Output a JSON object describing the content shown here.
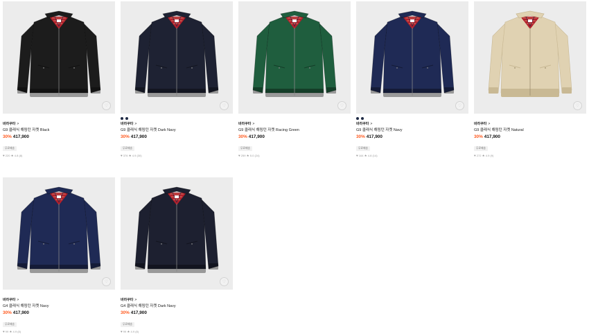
{
  "products": [
    {
      "brand": "바라쿠타",
      "brand_chevron": ">",
      "name": "G9 클래식 해링턴 자켓 Black",
      "discount": "30%",
      "price": "417,900",
      "badge": "무료배송",
      "likes": "220",
      "rating": "4.8 (8)",
      "color": "#1c1c1c",
      "colors_count": 0,
      "heart": "heart-outline-icon"
    },
    {
      "brand": "바라쿠타",
      "brand_chevron": ">",
      "name": "G9 클래식 해링턴 자켓 Dark Navy",
      "discount": "30%",
      "price": "417,900",
      "badge": "무료배송",
      "likes": "376",
      "rating": "4.9 (30)",
      "color": "#1e2233",
      "colors_count": 2,
      "heart": "heart-outline-icon"
    },
    {
      "brand": "바라쿠타",
      "brand_chevron": ">",
      "name": "G9 클래식 해링턴 자켓 Racing Green",
      "discount": "30%",
      "price": "417,900",
      "badge": "무료배송",
      "likes": "259",
      "rating": "5.0 (24)",
      "color": "#1f5e3e",
      "colors_count": 0,
      "heart": "heart-outline-icon"
    },
    {
      "brand": "바라쿠타",
      "brand_chevron": ">",
      "name": "G9 클래식 해링턴 자켓 Navy",
      "discount": "30%",
      "price": "417,900",
      "badge": "무료배송",
      "likes": "164",
      "rating": "4.8 (14)",
      "color": "#1f2a55",
      "colors_count": 2,
      "heart": "heart-outline-icon"
    },
    {
      "brand": "바라쿠타",
      "brand_chevron": ">",
      "name": "G9 클래식 해링턴 자켓 Natural",
      "discount": "30%",
      "price": "417,900",
      "badge": "무료배송",
      "likes": "272",
      "rating": "4.9 (9)",
      "color": "#e0d2b2",
      "colors_count": 0,
      "heart": "heart-outline-icon"
    },
    {
      "brand": "바라쿠타",
      "brand_chevron": ">",
      "name": "G4 클래식 해링턴 자켓 Navy",
      "discount": "30%",
      "price": "417,900",
      "badge": "무료배송",
      "likes": "99",
      "rating": "4.9 (8)",
      "color": "#1f2a55",
      "colors_count": 0,
      "heart": "heart-outline-icon"
    },
    {
      "brand": "바라쿠타",
      "brand_chevron": ">",
      "name": "G4 클래식 해링턴 자켓 Dark Navy",
      "discount": "30%",
      "price": "417,900",
      "badge": "무료배송",
      "likes": "99",
      "rating": "4.9 (8)",
      "color": "#1d2030",
      "colors_count": 0,
      "heart": "heart-outline-icon"
    }
  ],
  "colors": {
    "discount": "#ff5a1f",
    "card_bg": "#ececec",
    "lining_red": "#b21f2b"
  }
}
